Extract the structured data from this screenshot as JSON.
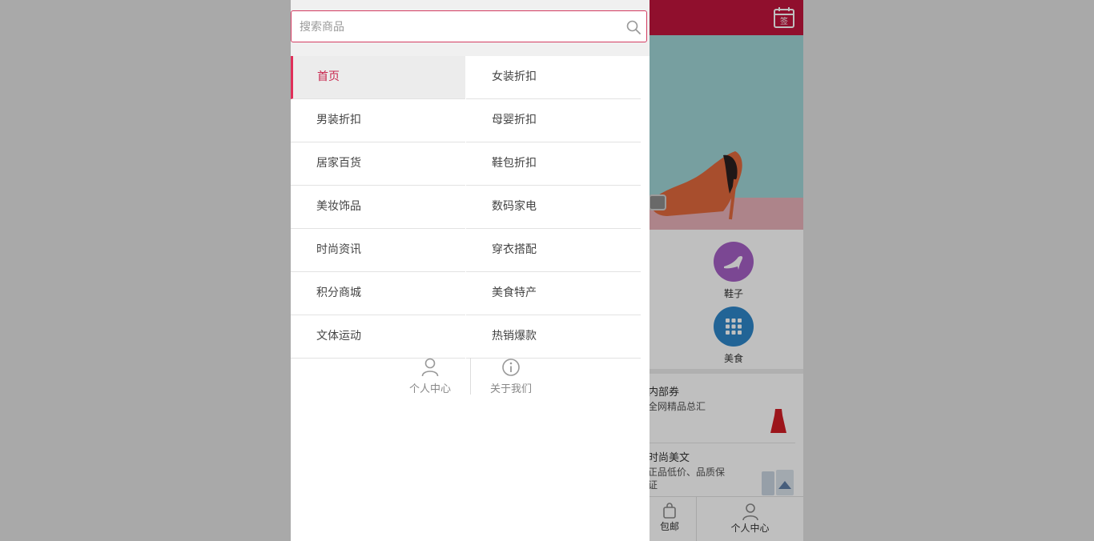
{
  "search": {
    "placeholder": "搜索商品",
    "value": ""
  },
  "menu": {
    "items": [
      {
        "label": "首页",
        "active": true
      },
      {
        "label": "女装折扣"
      },
      {
        "label": "男装折扣"
      },
      {
        "label": "母婴折扣"
      },
      {
        "label": "居家百货"
      },
      {
        "label": "鞋包折扣"
      },
      {
        "label": "美妆饰品"
      },
      {
        "label": "数码家电"
      },
      {
        "label": "时尚资讯"
      },
      {
        "label": "穿衣搭配"
      },
      {
        "label": "积分商城"
      },
      {
        "label": "美食特产"
      },
      {
        "label": "文体运动"
      },
      {
        "label": "热销爆款"
      }
    ]
  },
  "drawer_footer": {
    "profile_label": "个人中心",
    "about_label": "关于我们"
  },
  "app": {
    "header": {
      "signin_icon_text": "签"
    },
    "categories": [
      {
        "label": "鞋子",
        "icon": "high-heel-icon",
        "color": "#a55fc4"
      },
      {
        "label": "美食",
        "icon": "grid-icon",
        "color": "#2e86c8"
      }
    ],
    "articles": [
      {
        "title": "内部券",
        "desc": "全网精品总汇"
      },
      {
        "title": "时尚美文",
        "desc": "正品低价、品质保\n证"
      }
    ],
    "tabbar": {
      "partial_label": "包邮",
      "profile_label": "个人中心"
    }
  },
  "colors": {
    "accent": "#c0143c",
    "active_text": "#c8254d"
  }
}
